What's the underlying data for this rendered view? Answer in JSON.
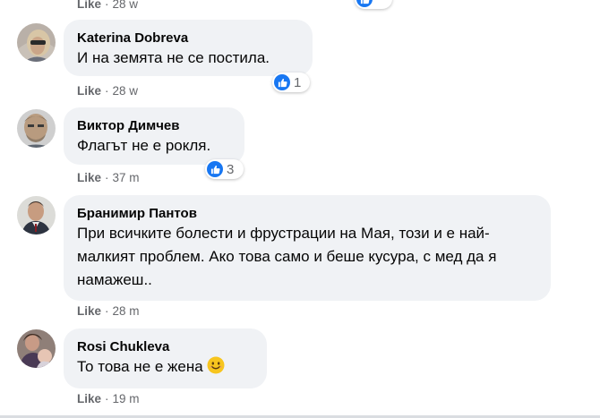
{
  "prev": {
    "like_label": "Like",
    "separator": "·",
    "time": "28 w"
  },
  "comments": [
    {
      "author": "Katerina Dobreva",
      "text": "И на земята не се постила.",
      "like_label": "Like",
      "separator": "·",
      "time": "28 w",
      "reaction_count": "1"
    },
    {
      "author": "Виктор Димчев",
      "text": "Флагът не е рокля.",
      "like_label": "Like",
      "separator": "·",
      "time": "37 m",
      "reaction_count": "3"
    },
    {
      "author": "Бранимир Пантов",
      "text": "При всичките болести и фрустрации на Мая, този и е най-малкият проблем. Ако това само и беше кусура, с мед да я намажеш..",
      "like_label": "Like",
      "separator": "·",
      "time": "28 m"
    },
    {
      "author": "Rosi Chukleva",
      "text": "То това не е жена",
      "emoji": "smiling-face-emoji",
      "like_label": "Like",
      "separator": "·",
      "time": "19 m"
    }
  ],
  "colors": {
    "bubble": "#f0f2f5",
    "meta_text": "#65676b",
    "like_blue": "#1877f2"
  }
}
